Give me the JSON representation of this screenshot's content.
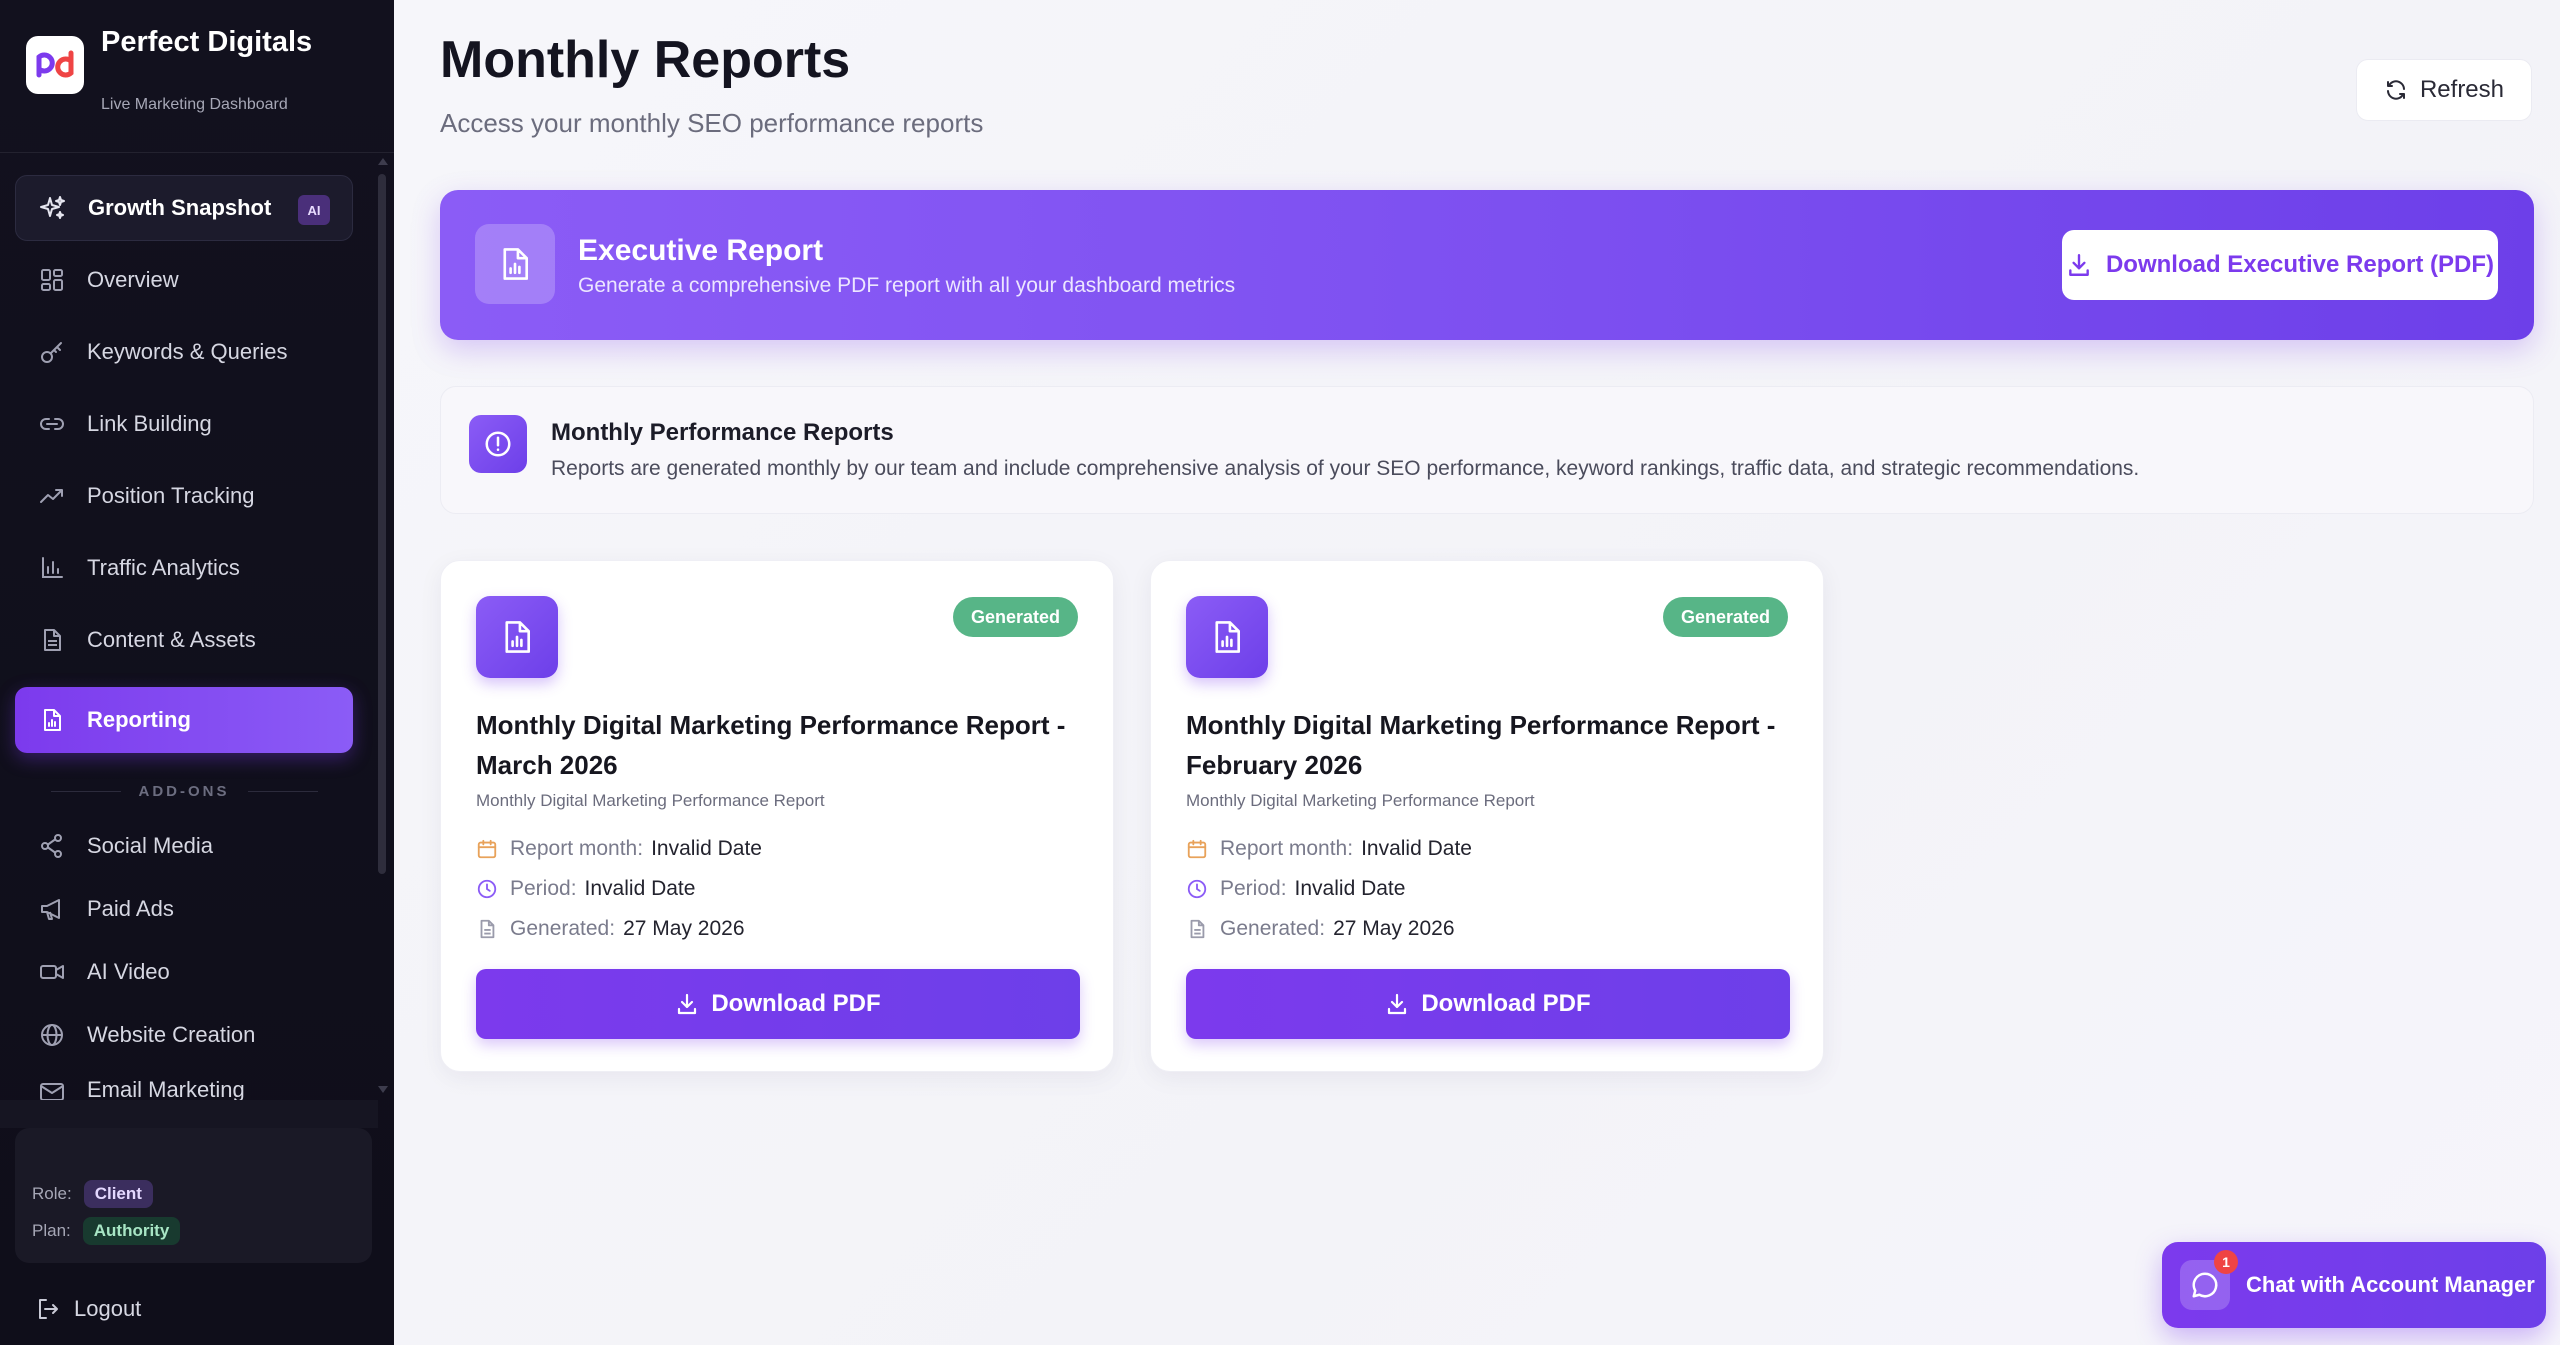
{
  "brand": {
    "name": "Perfect Digitals",
    "subtitle": "Live Marketing Dashboard"
  },
  "sidebar": {
    "items": [
      {
        "label": "Growth Snapshot",
        "icon": "sparkles-icon",
        "badge": "AI"
      },
      {
        "label": "Overview",
        "icon": "grid-icon"
      },
      {
        "label": "Keywords & Queries",
        "icon": "key-icon"
      },
      {
        "label": "Link Building",
        "icon": "link-icon"
      },
      {
        "label": "Position Tracking",
        "icon": "trending-up-icon"
      },
      {
        "label": "Traffic Analytics",
        "icon": "bar-chart-icon"
      },
      {
        "label": "Content & Assets",
        "icon": "document-icon"
      },
      {
        "label": "Reporting",
        "icon": "report-icon",
        "active": true
      }
    ],
    "addons_label": "ADD-ONS",
    "addons": [
      {
        "label": "Social Media",
        "icon": "share-icon"
      },
      {
        "label": "Paid Ads",
        "icon": "megaphone-icon"
      },
      {
        "label": "AI Video",
        "icon": "video-icon"
      },
      {
        "label": "Website Creation",
        "icon": "globe-icon"
      },
      {
        "label": "Email Marketing",
        "icon": "mail-icon"
      }
    ],
    "account": {
      "role_label": "Role:",
      "role_value": "Client",
      "plan_label": "Plan:",
      "plan_value": "Authority"
    },
    "logout_label": "Logout"
  },
  "header": {
    "title": "Monthly Reports",
    "subtitle": "Access your monthly SEO performance reports",
    "refresh_label": "Refresh"
  },
  "executive": {
    "title": "Executive Report",
    "subtitle": "Generate a comprehensive PDF report with all your dashboard metrics",
    "button_label": "Download Executive Report (PDF)"
  },
  "info": {
    "title": "Monthly Performance Reports",
    "text": "Reports are generated monthly by our team and include comprehensive analysis of your SEO performance, keyword rankings, traffic data, and strategic recommendations."
  },
  "reports": [
    {
      "status": "Generated",
      "title": "Monthly Digital Marketing Performance Report - March 2026",
      "subtitle": "Monthly Digital Marketing Performance Report",
      "month_label": "Report month:",
      "month_value": "Invalid Date",
      "period_label": "Period:",
      "period_value": "Invalid Date",
      "generated_label": "Generated:",
      "generated_value": "27 May 2026",
      "button_label": "Download PDF"
    },
    {
      "status": "Generated",
      "title": "Monthly Digital Marketing Performance Report - February 2026",
      "subtitle": "Monthly Digital Marketing Performance Report",
      "month_label": "Report month:",
      "month_value": "Invalid Date",
      "period_label": "Period:",
      "period_value": "Invalid Date",
      "generated_label": "Generated:",
      "generated_value": "27 May 2026",
      "button_label": "Download PDF"
    }
  ],
  "chat": {
    "label": "Chat with Account Manager",
    "count": "1"
  },
  "colors": {
    "accent": "#7c3aed",
    "sidebar_bg": "#12111e",
    "status_generated": "#57b587",
    "meta_calendar": "#e8a25a",
    "meta_clock": "#8b5cf6"
  }
}
